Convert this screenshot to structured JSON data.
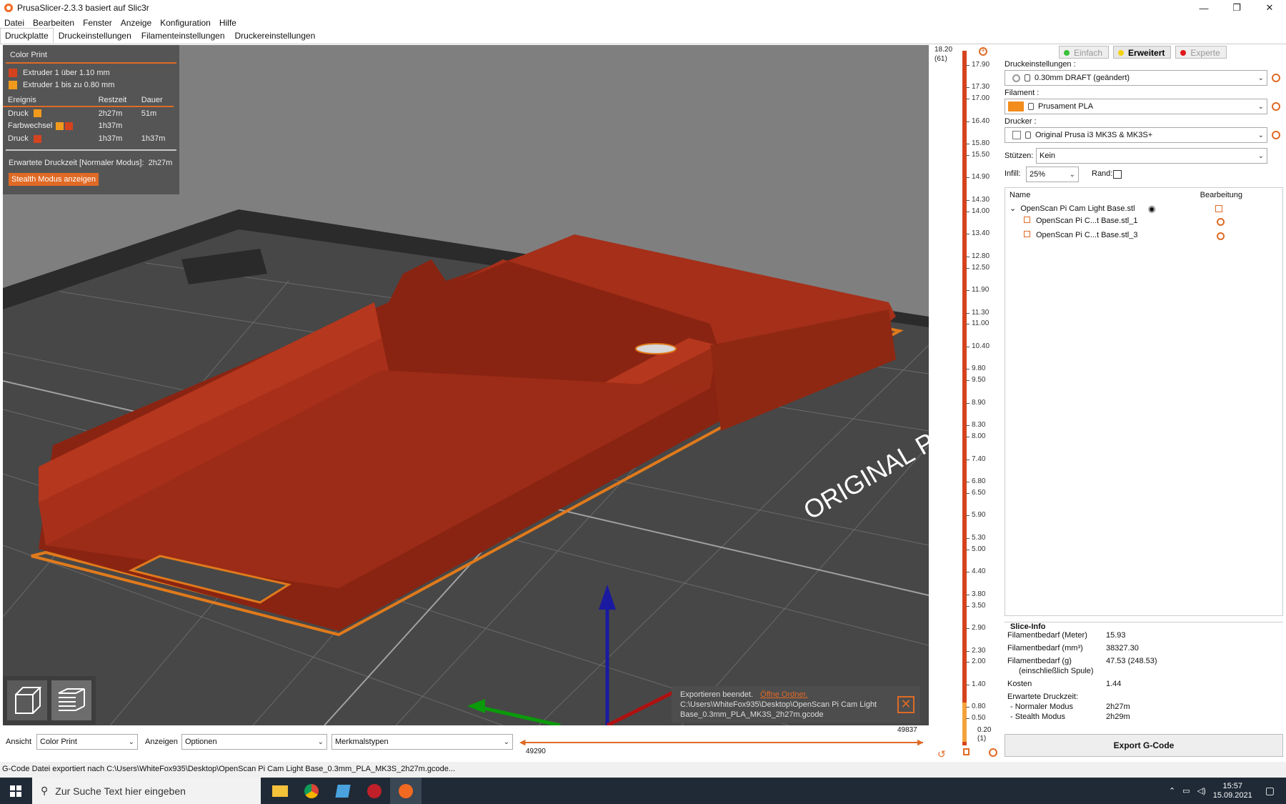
{
  "window": {
    "title": "PrusaSlicer-2.3.3 basiert auf Slic3r",
    "min": "—",
    "max": "❐",
    "close": "✕"
  },
  "menu": [
    "Datei",
    "Bearbeiten",
    "Fenster",
    "Anzeige",
    "Konfiguration",
    "Hilfe"
  ],
  "tabs": [
    "Druckplatte",
    "Druckeinstellungen",
    "Filamenteinstellungen",
    "Druckereinstellungen"
  ],
  "legend": {
    "title": "Color Print",
    "items": [
      {
        "label": "Extruder 1 über 1.10 mm",
        "color": "#d5431e"
      },
      {
        "label": "Extruder 1 bis zu 0.80 mm",
        "color": "#f29a1c"
      }
    ],
    "columns": [
      "Ereignis",
      "Restzeit",
      "Dauer"
    ],
    "rows": [
      {
        "event": "Druck",
        "rest": "2h27m",
        "dur": "51m"
      },
      {
        "event": "Farbwechsel",
        "rest": "1h37m",
        "dur": ""
      },
      {
        "event": "Druck",
        "rest": "1h37m",
        "dur": "1h37m"
      }
    ],
    "time_label": "Erwartete Druckzeit [Normaler Modus]:",
    "time_value": "2h27m",
    "stealth_button": "Stealth Modus anzeigen"
  },
  "bed_text": "ORIGINAL PR",
  "toast": {
    "line1": "Exportieren beendet.",
    "link": "Öffne Ordner.",
    "line2": "C:\\Users\\WhiteFox935\\Desktop\\OpenScan Pi Cam Light",
    "line3": "Base_0.3mm_PLA_MK3S_2h27m.gcode"
  },
  "layers": {
    "top_value": "18.20",
    "top_count": "(61)",
    "bottom_value": "0.20",
    "bottom_count": "(1)",
    "ticks": [
      "17.90",
      "17.30",
      "17.00",
      "16.40",
      "15.80",
      "15.50",
      "14.90",
      "14.30",
      "14.00",
      "13.40",
      "12.80",
      "12.50",
      "11.90",
      "11.30",
      "11.00",
      "10.40",
      "9.80",
      "9.50",
      "8.90",
      "8.30",
      "8.00",
      "7.40",
      "6.80",
      "6.50",
      "5.90",
      "5.30",
      "5.00",
      "4.40",
      "3.80",
      "3.50",
      "2.90",
      "2.30",
      "2.00",
      "1.40",
      "0.80",
      "0.50"
    ]
  },
  "modes": [
    "Einfach",
    "Erweitert",
    "Experte"
  ],
  "settings": {
    "print_label": "Druckeinstellungen :",
    "print_value": "0.30mm DRAFT (geändert)",
    "filament_label": "Filament :",
    "filament_value": "Prusament PLA",
    "printer_label": "Drucker :",
    "printer_value": "Original Prusa i3 MK3S & MK3S+",
    "supports_label": "Stützen:",
    "supports_value": "Kein",
    "infill_label": "Infill:",
    "infill_value": "25%",
    "brim_label": "Rand:"
  },
  "objects": {
    "col_name": "Name",
    "col_edit": "Bearbeitung",
    "root": "OpenScan Pi Cam Light Base.stl",
    "children": [
      "OpenScan Pi C...t Base.stl_1",
      "OpenScan Pi C...t Base.stl_3"
    ]
  },
  "slice_info": {
    "title": "Slice-Info",
    "rows": [
      {
        "k": "Filamentbedarf (Meter)",
        "v": "15.93"
      },
      {
        "k": "Filamentbedarf (mm³)",
        "v": "38327.30"
      },
      {
        "k": "Filamentbedarf (g)",
        "v": "47.53 (248.53)"
      },
      {
        "k": "(einschließlich Spule)",
        "v": ""
      },
      {
        "k": "Kosten",
        "v": "1.44"
      },
      {
        "k": "Erwartete Druckzeit:",
        "v": ""
      },
      {
        "k": "- Normaler Modus",
        "v": "2h27m"
      },
      {
        "k": "- Stealth Modus",
        "v": "2h29m"
      }
    ]
  },
  "export_button": "Export G-Code",
  "bottom": {
    "view_label": "Ansicht",
    "view_value": "Color Print",
    "show_label": "Anzeigen",
    "show_value": "Optionen",
    "features_value": "Merkmalstypen",
    "slider_left": "49290",
    "slider_right": "49837"
  },
  "status": "G-Code Datei exportiert nach C:\\Users\\WhiteFox935\\Desktop\\OpenScan Pi Cam Light Base_0.3mm_PLA_MK3S_2h27m.gcode...",
  "taskbar": {
    "search": "Zur Suche Text hier eingeben",
    "time": "15:57",
    "date": "15.09.2021"
  }
}
